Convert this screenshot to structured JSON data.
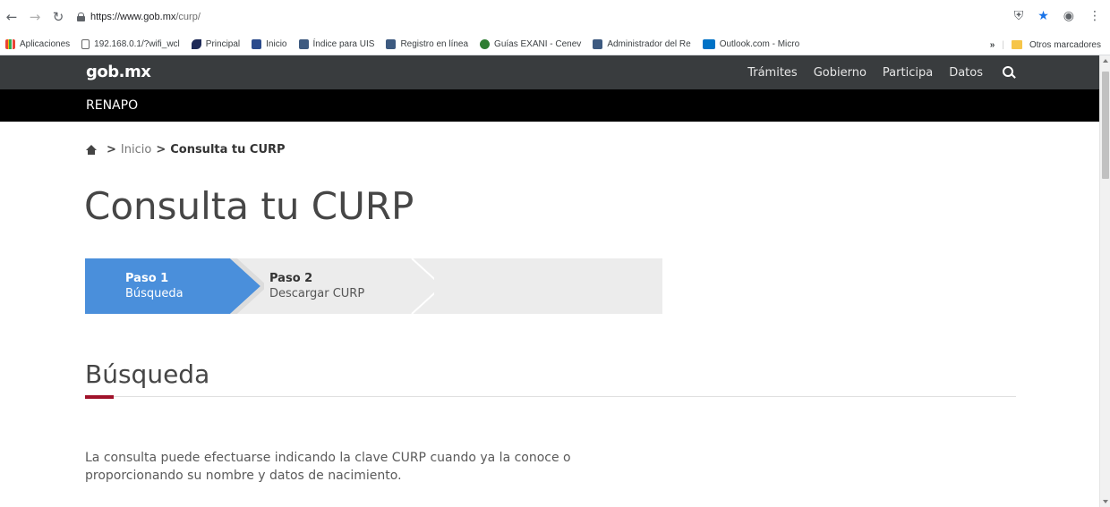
{
  "browser": {
    "url_host": "https://www.gob.mx",
    "url_path": "/curp/",
    "bookmarks": [
      {
        "label": "Aplicaciones",
        "icon": "apps-grid-icon",
        "color": "#4285f4"
      },
      {
        "label": "192.168.0.1/?wifi_wcl",
        "icon": "page-icon",
        "color": "#ffffff"
      },
      {
        "label": "Principal",
        "icon": "bird-icon",
        "color": "#1e2a57"
      },
      {
        "label": "Inicio",
        "icon": "site-icon",
        "color": "#2b4b8c"
      },
      {
        "label": "Índice para UIS",
        "icon": "site-icon",
        "color": "#3d5a80"
      },
      {
        "label": "Registro en línea",
        "icon": "site-icon",
        "color": "#3d5a80"
      },
      {
        "label": "Guías EXANI - Cenev",
        "icon": "music-icon",
        "color": "#2e7d32"
      },
      {
        "label": "Administrador del Re",
        "icon": "site-icon",
        "color": "#3d5a80"
      },
      {
        "label": "Outlook.com - Micro",
        "icon": "outlook-icon",
        "color": "#0072c6"
      }
    ],
    "more_label": "»",
    "other_bookmarks": "Otros marcadores"
  },
  "site": {
    "logo": "gob.mx",
    "nav": [
      "Trámites",
      "Gobierno",
      "Participa",
      "Datos"
    ],
    "subheader": "RENAPO"
  },
  "breadcrumb": {
    "sep": ">",
    "inicio": "Inicio",
    "current": "Consulta tu CURP"
  },
  "page_title": "Consulta tu CURP",
  "steps": [
    {
      "title": "Paso 1",
      "label": "Búsqueda",
      "active": true
    },
    {
      "title": "Paso 2",
      "label": "Descargar CURP",
      "active": false
    }
  ],
  "section": {
    "title": "Búsqueda",
    "description": "La consulta puede efectuarse indicando la clave CURP cuando ya la conoce o proporcionando su nombre y datos de nacimiento."
  },
  "colors": {
    "nav_bg": "#393c3e",
    "step_active": "#4a8fdb",
    "accent_red": "#a0122a"
  }
}
